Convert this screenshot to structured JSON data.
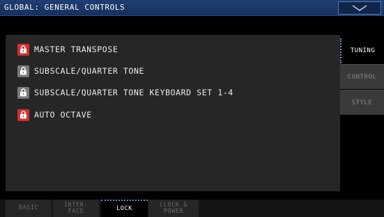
{
  "header": {
    "title": "GLOBAL: GENERAL CONTROLS",
    "menu_icon": "chevron-down-icon"
  },
  "locks": [
    {
      "label": "MASTER TRANSPOSE",
      "locked": true,
      "color": "#d4302f"
    },
    {
      "label": "SUBSCALE/QUARTER TONE",
      "locked": false,
      "color": "#7a7a7a"
    },
    {
      "label": "SUBSCALE/QUARTER TONE KEYBOARD SET 1-4",
      "locked": false,
      "color": "#7a7a7a"
    },
    {
      "label": "AUTO OCTAVE",
      "locked": true,
      "color": "#d4302f"
    }
  ],
  "side_tabs": [
    {
      "label": "TUNING",
      "active": true
    },
    {
      "label": "CONTROL",
      "active": false
    },
    {
      "label": "STYLE",
      "active": false
    }
  ],
  "bottom_tabs": [
    {
      "line1": "BASIC",
      "line2": "",
      "active": false
    },
    {
      "line1": "INTER-",
      "line2": "FACE",
      "active": false
    },
    {
      "line1": "LOCK",
      "line2": "",
      "active": true
    },
    {
      "line1": "CLOCK &",
      "line2": "POWER",
      "active": false
    }
  ],
  "colors": {
    "header_bg": "#1f3f74",
    "lock_on": "#d4302f",
    "lock_off": "#7a7a7a",
    "accent_dotted": "#6b8fd0"
  }
}
